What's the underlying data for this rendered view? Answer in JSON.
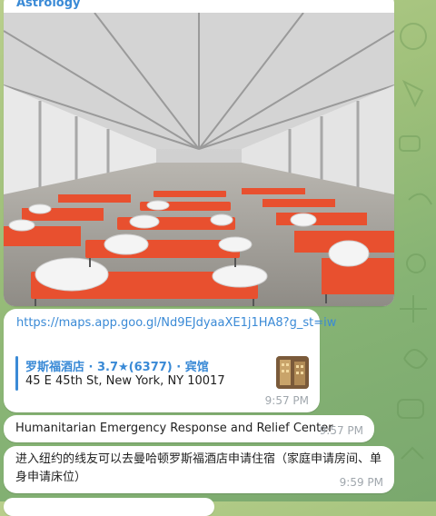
{
  "top_bubble": {
    "sender_name": "Astrology"
  },
  "link_message": {
    "url": "https://maps.app.goo.gl/Nd9EJdyaaXE1j1HA8?g_st=iw",
    "preview_title": "罗斯福酒店 · 3.7★(6377) · 宾馆",
    "preview_address": "45 E 45th St, New York, NY 10017",
    "time": "9:57 PM"
  },
  "message_center": {
    "text": "Humanitarian Emergency Response and Relief Center",
    "time": "9:57 PM"
  },
  "message_cn": {
    "text": "进入纽约的线友可以去曼哈顿罗斯福酒店申请住宿（家庭申请房间、单身申请床位）",
    "time": "9:59 PM"
  },
  "colors": {
    "link": "#3a8ad6",
    "background": "#9fc07a",
    "cot": "#e8502f"
  }
}
